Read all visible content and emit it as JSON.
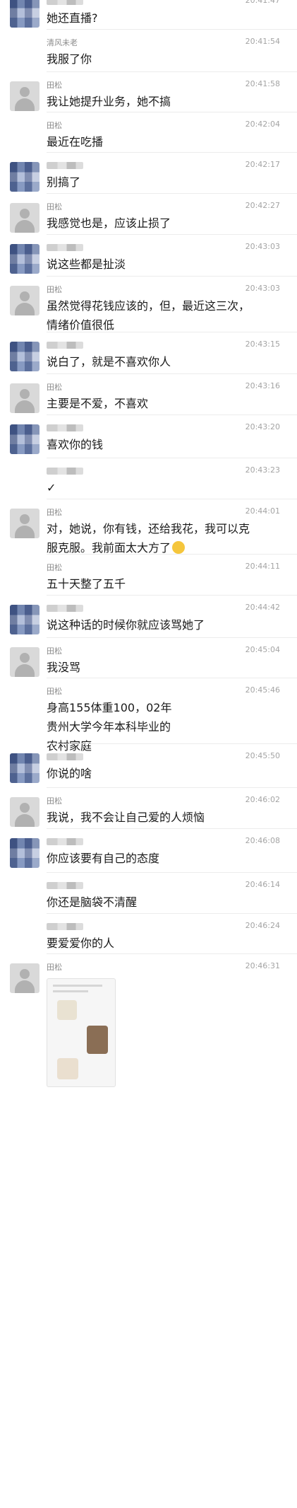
{
  "messages": [
    {
      "name": "",
      "name_blurred": true,
      "avatar": "mosaic",
      "time": "20:41:47",
      "text": "她还直播?"
    },
    {
      "name": "清风未老",
      "name_blurred": false,
      "avatar": "blank",
      "time": "20:41:54",
      "text": "我服了你"
    },
    {
      "name": "田松",
      "name_blurred": false,
      "avatar": "grey",
      "time": "20:41:58",
      "text": "我让她提升业务，她不搞"
    },
    {
      "name": "田松",
      "name_blurred": false,
      "avatar": "blank",
      "time": "20:42:04",
      "text": "最近在吃播"
    },
    {
      "name": "",
      "name_blurred": true,
      "avatar": "mosaic",
      "time": "20:42:17",
      "text": "别搞了"
    },
    {
      "name": "田松",
      "name_blurred": false,
      "avatar": "grey",
      "time": "20:42:27",
      "text": "我感觉也是，应该止损了"
    },
    {
      "name": "",
      "name_blurred": true,
      "avatar": "mosaic",
      "time": "20:43:03",
      "text": "说这些都是扯淡"
    },
    {
      "name": "田松",
      "name_blurred": false,
      "avatar": "grey",
      "time": "20:43:03",
      "text": "虽然觉得花钱应该的，但，最近这三次，\n情绪价值很低"
    },
    {
      "name": "",
      "name_blurred": true,
      "avatar": "mosaic",
      "time": "20:43:15",
      "text": "说白了，就是不喜欢你人"
    },
    {
      "name": "田松",
      "name_blurred": false,
      "avatar": "grey",
      "time": "20:43:16",
      "text": "主要是不爱，不喜欢"
    },
    {
      "name": "",
      "name_blurred": true,
      "avatar": "mosaic",
      "time": "20:43:20",
      "text": "喜欢你的钱"
    },
    {
      "name": "",
      "name_blurred": true,
      "avatar": "blank",
      "time": "20:43:23",
      "text": "✓"
    },
    {
      "name": "田松",
      "name_blurred": false,
      "avatar": "grey",
      "time": "20:44:01",
      "text": "对，她说，你有钱，还给我花，我可以克\n服克服。我前面太大方了",
      "emoji": "crying-face"
    },
    {
      "name": "田松",
      "name_blurred": false,
      "avatar": "blank",
      "time": "20:44:11",
      "text": "五十天整了五千"
    },
    {
      "name": "",
      "name_blurred": true,
      "avatar": "mosaic",
      "time": "20:44:42",
      "text": "说这种话的时候你就应该骂她了"
    },
    {
      "name": "田松",
      "name_blurred": false,
      "avatar": "grey",
      "time": "20:45:04",
      "text": "我没骂"
    },
    {
      "name": "田松",
      "name_blurred": false,
      "avatar": "blank",
      "time": "20:45:46",
      "text": "身高155体重100，02年\n贵州大学今年本科毕业的\n农村家庭"
    },
    {
      "name": "",
      "name_blurred": true,
      "avatar": "mosaic",
      "time": "20:45:50",
      "text": "你说的啥"
    },
    {
      "name": "田松",
      "name_blurred": false,
      "avatar": "grey",
      "time": "20:46:02",
      "text": "我说，我不会让自己爱的人烦恼"
    },
    {
      "name": "",
      "name_blurred": true,
      "avatar": "mosaic",
      "time": "20:46:08",
      "text": "你应该要有自己的态度"
    },
    {
      "name": "",
      "name_blurred": true,
      "avatar": "blank",
      "time": "20:46:14",
      "text": "你还是脑袋不清醒"
    },
    {
      "name": "",
      "name_blurred": true,
      "avatar": "blank",
      "time": "20:46:24",
      "text": "要爱爱你的人"
    },
    {
      "name": "田松",
      "name_blurred": false,
      "avatar": "grey",
      "time": "20:46:31",
      "text": "",
      "image": true
    }
  ]
}
